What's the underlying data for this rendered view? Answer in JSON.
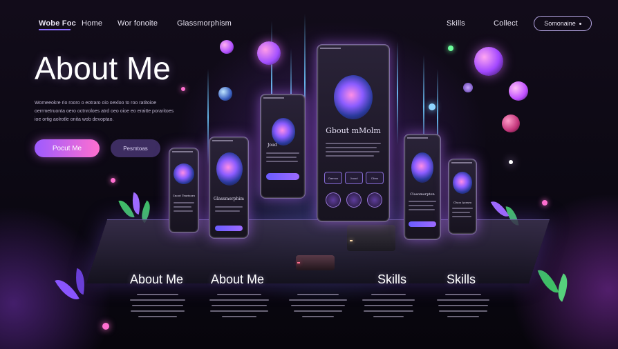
{
  "nav": {
    "brand": "Wobe Foc",
    "links": [
      "Home",
      "Wor fonoite",
      "Glassmorphism",
      "Skills",
      "Collect"
    ],
    "button_label": "Somonaine"
  },
  "hero": {
    "title": "About Me",
    "description": "Womeeokre rio rooro o eotraro oio oexloo to roo ratitoioe oerrmetruonta oero octnroloes atrd oeo oioe eo eraitte poraritoes ioe ortig aolrotle onita wob devoptao.",
    "primary_button": "Pocut Me",
    "secondary_button": "Pesmtoas"
  },
  "cards": {
    "c1_title": "Cnoot Tearisoro",
    "c2_title": "Glassmorphim",
    "c3_title": "Joud",
    "c4_title": "Gbout mMolm",
    "c4_pill1": "Oarmoo",
    "c4_pill2": "Jouod",
    "c4_pill3": "Cibno",
    "c5_title": "Clasomorpton",
    "c6_title": "Clsoo Aoraro"
  },
  "bottom": {
    "headings": [
      "About Me",
      "About Me",
      "Skills",
      "Skills"
    ]
  },
  "colors": {
    "accent": "#8b6cff",
    "pink": "#ff6fd0",
    "background": "#0a0710"
  }
}
